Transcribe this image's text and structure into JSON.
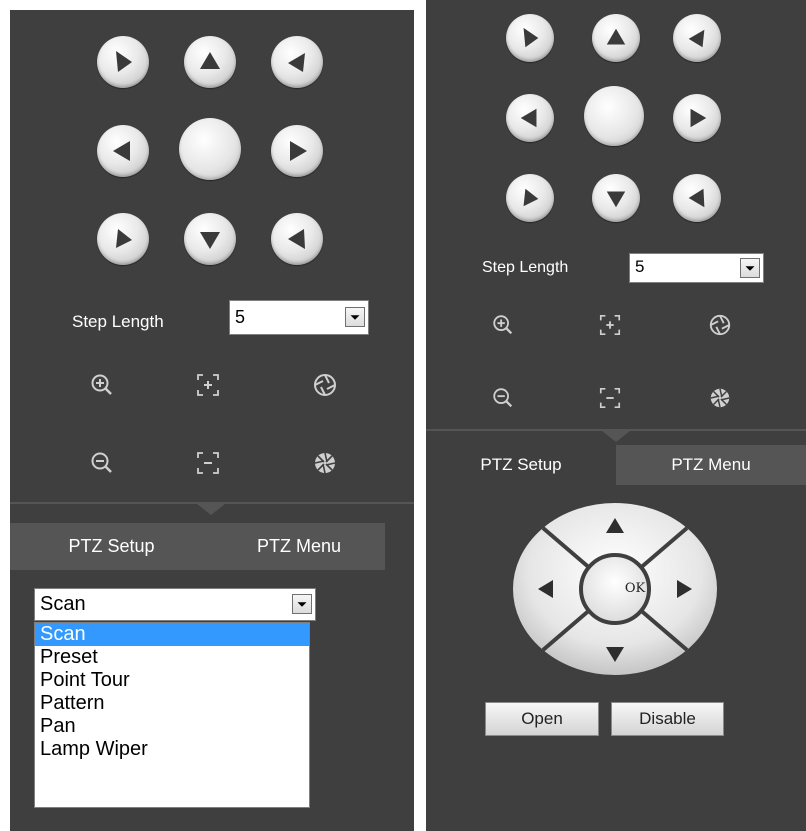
{
  "left_panel": {
    "step_length_label": "Step Length",
    "step_length_value": "5",
    "tabs": [
      "PTZ Setup",
      "PTZ Menu"
    ],
    "function_select": {
      "value": "Scan",
      "options": [
        "Scan",
        "Preset",
        "Point Tour",
        "Pattern",
        "Pan",
        "Lamp Wiper"
      ],
      "highlighted": "Scan"
    }
  },
  "right_panel": {
    "step_length_label": "Step Length",
    "step_length_value": "5",
    "tabs": [
      "PTZ Setup",
      "PTZ Menu"
    ],
    "menu_pad": {
      "ok_label": "OK"
    },
    "buttons": {
      "open": "Open",
      "disable": "Disable"
    }
  },
  "icons": {
    "direction": [
      "up-left-arrow-icon",
      "up-arrow-icon",
      "up-right-arrow-icon",
      "left-arrow-icon",
      "right-arrow-icon",
      "down-left-arrow-icon",
      "down-arrow-icon",
      "down-right-arrow-icon"
    ],
    "tools": [
      "zoom-in-icon",
      "focus-near-icon",
      "iris-open-icon",
      "zoom-out-icon",
      "focus-far-icon",
      "iris-close-icon"
    ]
  },
  "colors": {
    "panel_bg": "#3f3f3f",
    "tab_bg": "#555555",
    "highlight": "#3399ff"
  }
}
